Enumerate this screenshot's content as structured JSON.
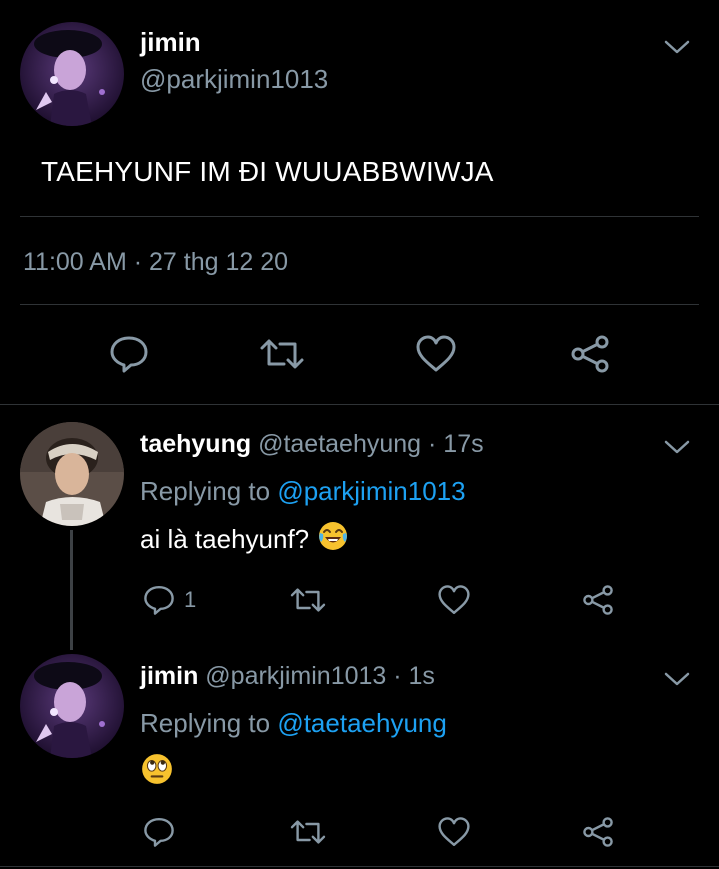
{
  "main_tweet": {
    "name": "jimin",
    "handle": "@parkjimin1013",
    "text": "TAEHYUNF IM ĐI WUUABBWIWJA",
    "timestamp": "11:00 AM · 27 thg 12 20",
    "icons": [
      "reply-icon",
      "retweet-icon",
      "like-icon",
      "share-icon",
      "chevron-down-icon"
    ]
  },
  "replies": [
    {
      "name": "taehyung",
      "handle_time": "@taetaehyung · 17s",
      "replying_prefix": "Replying to ",
      "replying_to": "@parkjimin1013",
      "text": "ai là taehyunf?",
      "emoji": "face-with-tears-of-joy",
      "reply_count": "1"
    },
    {
      "name": "jimin",
      "handle_time": "@parkjimin1013 · 1s",
      "replying_prefix": "Replying to ",
      "replying_to": "@taetaehyung",
      "text": "",
      "emoji": "face-with-rolling-eyes"
    }
  ],
  "colors": {
    "background": "#000000",
    "text": "#ffffff",
    "secondary": "#8899a6",
    "link": "#1da1f2",
    "divider": "#2f3336"
  }
}
